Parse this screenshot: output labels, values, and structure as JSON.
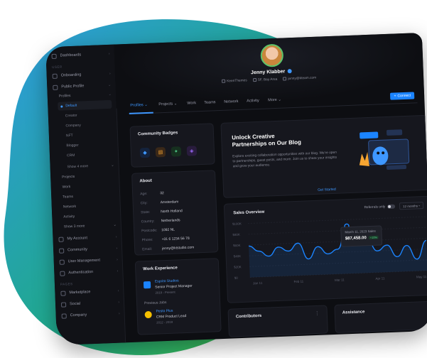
{
  "colors": {
    "accent": "#3e97ff",
    "background": "#0d0e12",
    "card": "#16171e",
    "success": "#50cd89"
  },
  "sidebar": {
    "top_item": "Dashboards",
    "section_user": "USER",
    "onboarding": "Onboarding",
    "public_profile": "Public Profile",
    "profiles": "Profiles",
    "default": "Default",
    "sub_items": [
      "Creator",
      "Company",
      "NFT",
      "Blogger",
      "CRM"
    ],
    "show_more": "Show 4 more",
    "profile_items": [
      "Projects",
      "Work",
      "Teams",
      "Network",
      "Activity"
    ],
    "show_more_2": "Show 3 more",
    "lower_items": [
      "My Account",
      "Community",
      "User Management",
      "Authentication"
    ],
    "section_pages": "PAGES",
    "pages_items": [
      "Marketplace",
      "Social",
      "Company"
    ]
  },
  "profile": {
    "name": "Jenny Klabber",
    "company": "KeenThemes",
    "location": "SF, Bay Area",
    "email": "jenny@kteam.com"
  },
  "tabs": [
    "Profiles",
    "Projects",
    "Work",
    "Teams",
    "Network",
    "Activity",
    "More"
  ],
  "connect_label": "Connect",
  "badges": {
    "title": "Community Badges",
    "icons": [
      "pulse-icon",
      "flame-icon",
      "star-icon",
      "gem-icon"
    ]
  },
  "about": {
    "title": "About",
    "rows": [
      {
        "k": "Age:",
        "v": "32"
      },
      {
        "k": "City:",
        "v": "Amsterdam"
      },
      {
        "k": "State:",
        "v": "North Holland"
      },
      {
        "k": "Country:",
        "v": "Netherlands"
      },
      {
        "k": "Postcode:",
        "v": "1092 NL"
      },
      {
        "k": "Phone:",
        "v": "+31 6 1234 56 78"
      },
      {
        "k": "Email:",
        "v": "jenny@ktstudio.com"
      }
    ]
  },
  "work": {
    "title": "Work Experience",
    "job1": {
      "company": "Esprito Studios",
      "role": "Senior Project Manager",
      "date": "2019 - Present"
    },
    "previous_label": "Previous Jobs",
    "job2": {
      "company": "Pesto Plus",
      "role": "CRM Product Lead",
      "date": "2012 - 2019"
    }
  },
  "blog": {
    "title_line1": "Unlock Creative",
    "title_line2": "Partnerships on Our Blog",
    "text": "Explore exciting collaboration opportunities with our blog. We're open to partnerships, guest posts, and more. Join us to share your insights and grow your audience.",
    "link": "Get Started"
  },
  "sales": {
    "title": "Sales Overview",
    "toggle_label": "Referrals only",
    "select_value": "12 months",
    "tooltip_date": "March 11, 2023 Sales",
    "tooltip_amount": "$87,458.00",
    "tooltip_pct": "+10%"
  },
  "chart_data": {
    "type": "area",
    "title": "Sales Overview",
    "x": [
      "Jan 11",
      "Feb 11",
      "Mar 11",
      "Apr 11",
      "May 11"
    ],
    "y_ticks": [
      "$100K",
      "$80K",
      "$60K",
      "$40K",
      "$20K",
      "$0"
    ],
    "ylim": [
      0,
      100
    ],
    "series": [
      {
        "values": [
          58,
          48,
          38,
          54,
          46,
          60,
          30,
          52,
          38,
          46,
          88,
          58,
          62,
          40,
          50,
          28,
          48,
          22,
          56
        ]
      }
    ]
  },
  "bottom": {
    "contributors": "Contributors",
    "assistance": "Assistance"
  }
}
